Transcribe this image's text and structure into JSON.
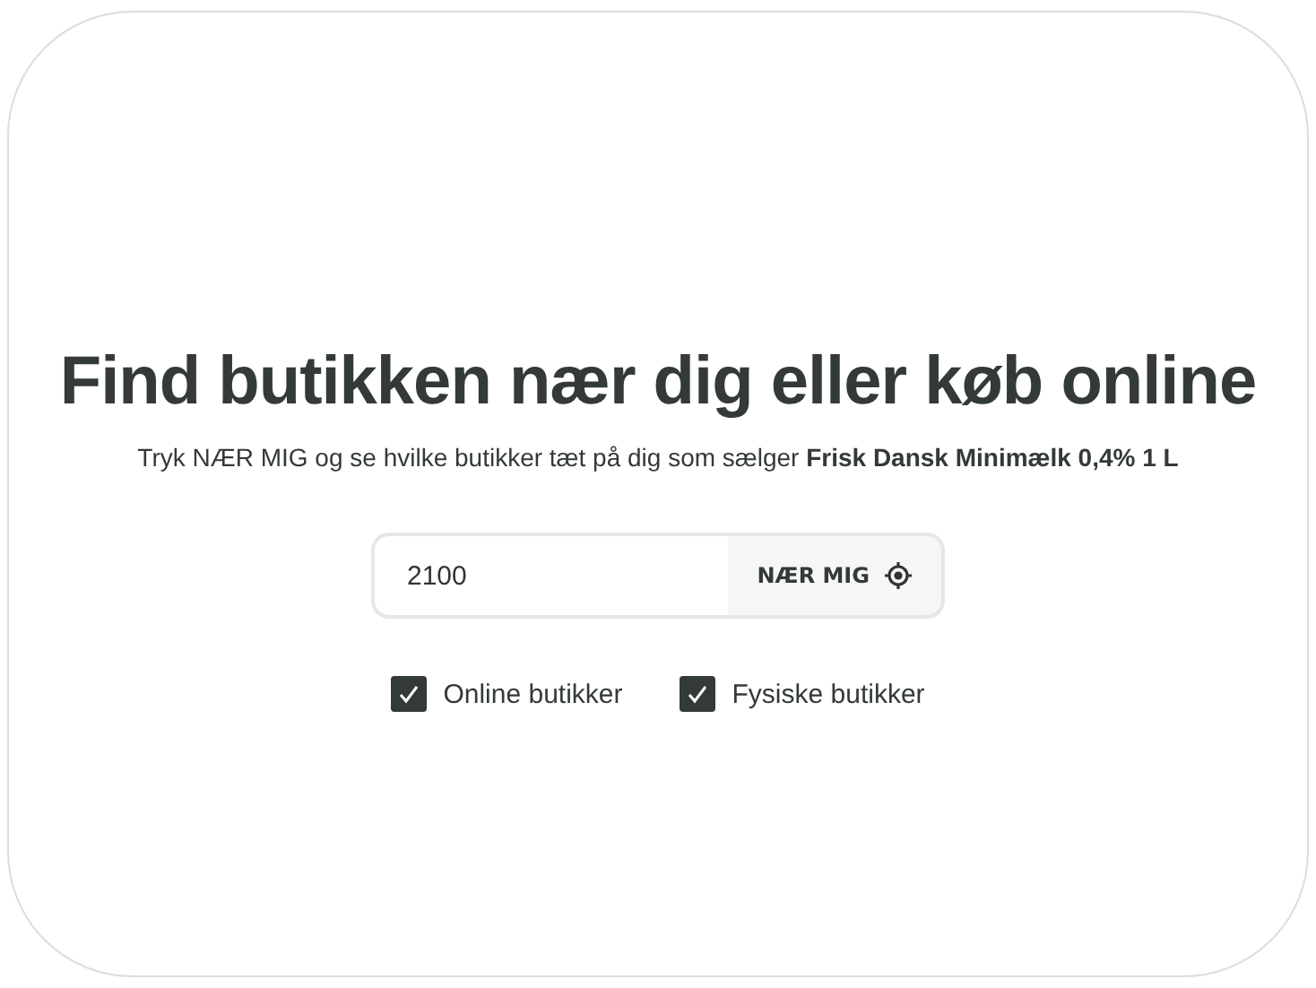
{
  "heading": "Find butikken nær dig eller køb online",
  "subtitle": "Tryk NÆR MIG og se hvilke butikker tæt på dig som sælger **Frisk Dansk Minimælk 0,4% 1 L**",
  "search": {
    "value": "2100",
    "button": "NÆR MIG"
  },
  "filters": [
    {
      "label": "Online butikker",
      "checked": true
    },
    {
      "label": "Fysiske butikker",
      "checked": true
    }
  ]
}
